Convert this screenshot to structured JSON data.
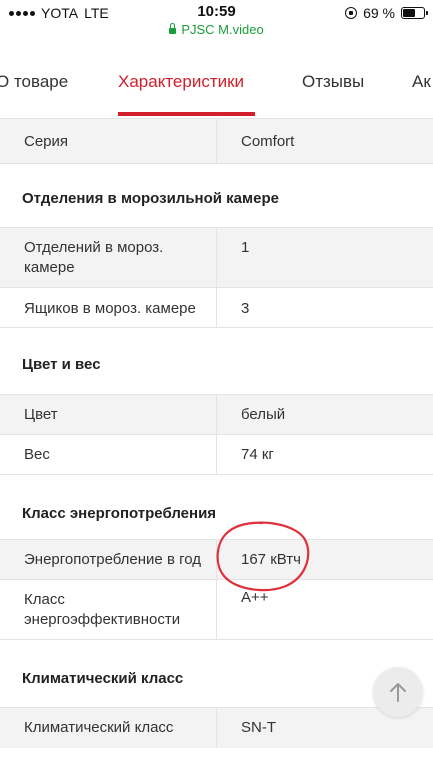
{
  "status_bar": {
    "carrier": "YOTA",
    "network": "LTE",
    "time": "10:59",
    "url": "PJSC M.video",
    "battery_percent": "69 %",
    "battery_level": 0.69
  },
  "tabs": [
    {
      "label": "О товаре"
    },
    {
      "label": "Характеристики"
    },
    {
      "label": "Отзывы"
    },
    {
      "label": "Ак"
    }
  ],
  "specs": {
    "series": {
      "name": "Серия",
      "value": "Comfort"
    },
    "freezer": {
      "title": "Отделения в морозильной камере",
      "rows": [
        {
          "name": "Отделений в мороз. камере",
          "value": "1"
        },
        {
          "name": "Ящиков в мороз. камере",
          "value": "3"
        }
      ]
    },
    "color_weight": {
      "title": "Цвет и вес",
      "rows": [
        {
          "name": "Цвет",
          "value": "белый"
        },
        {
          "name": "Вес",
          "value": "74 кг"
        }
      ]
    },
    "energy": {
      "title": "Класс энергопотребления",
      "rows": [
        {
          "name": "Энергопотребление в год",
          "value": "167 кВтч"
        },
        {
          "name": "Класс энергоэффективности",
          "value": "A++"
        }
      ]
    },
    "climate": {
      "title": "Климатический класс",
      "rows": [
        {
          "name": "Климатический класс",
          "value": "SN-T"
        }
      ]
    }
  },
  "colors": {
    "accent": "#d21f2b",
    "url_green": "#1a9e3b",
    "row_shade": "#f3f3f3",
    "annotation": "#e0303c"
  },
  "icons": {
    "scroll_top": "arrow-up-icon",
    "lock": "lock-icon",
    "rotation_lock": "rotation-lock-icon",
    "battery": "battery-icon"
  }
}
